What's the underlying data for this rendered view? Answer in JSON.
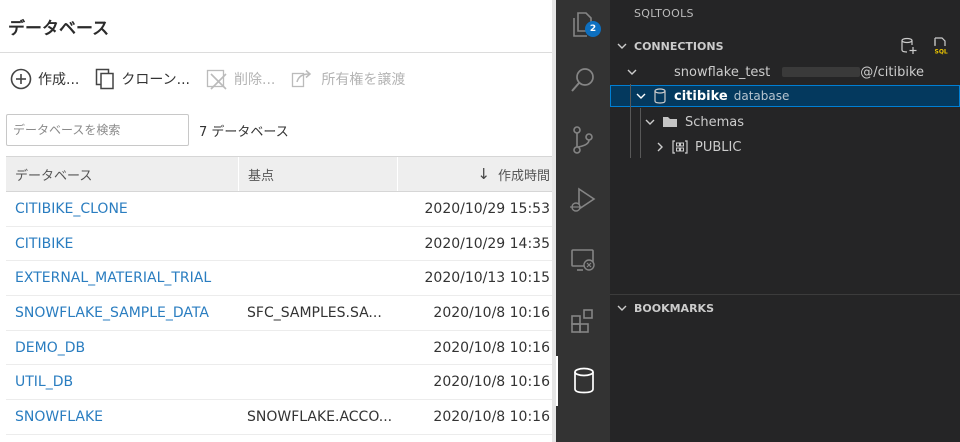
{
  "snowflake": {
    "title": "データベース",
    "toolbar": {
      "create": "作成...",
      "clone": "クローン...",
      "delete": "削除...",
      "transfer": "所有権を譲渡"
    },
    "search_placeholder": "データベースを検索",
    "count_text": "7 データベース",
    "columns": [
      "データベース",
      "基点",
      "作成時間"
    ],
    "rows": [
      {
        "name": "CITIBIKE_CLONE",
        "origin": "",
        "created": "2020/10/29 15:53"
      },
      {
        "name": "CITIBIKE",
        "origin": "",
        "created": "2020/10/29 14:35"
      },
      {
        "name": "EXTERNAL_MATERIAL_TRIAL",
        "origin": "",
        "created": "2020/10/13 10:15"
      },
      {
        "name": "SNOWFLAKE_SAMPLE_DATA",
        "origin": "SFC_SAMPLES.SA...",
        "created": "2020/10/8 10:16"
      },
      {
        "name": "DEMO_DB",
        "origin": "",
        "created": "2020/10/8 10:16"
      },
      {
        "name": "UTIL_DB",
        "origin": "",
        "created": "2020/10/8 10:16"
      },
      {
        "name": "SNOWFLAKE",
        "origin": "SNOWFLAKE.ACCO...",
        "created": "2020/10/8 10:16"
      }
    ]
  },
  "activity_bar": {
    "badge": "2",
    "icons": [
      "explorer-icon",
      "search-icon",
      "source-control-icon",
      "run-debug-icon",
      "remote-explorer-icon",
      "extensions-icon",
      "database-icon"
    ]
  },
  "sqltools": {
    "title": "SQLTOOLS",
    "connections_label": "CONNECTIONS",
    "connection_name": "snowflake_test",
    "connection_suffix": "@/citibike",
    "database_name": "citibike",
    "database_desc": "database",
    "schemas_label": "Schemas",
    "schema_name": "PUBLIC",
    "bookmarks_label": "BOOKMARKS"
  },
  "colors": {
    "link": "#2a7dc0",
    "vscode_selection": "#04395e",
    "vscode_focus": "#007fd4",
    "badge": "#0e70c0"
  }
}
